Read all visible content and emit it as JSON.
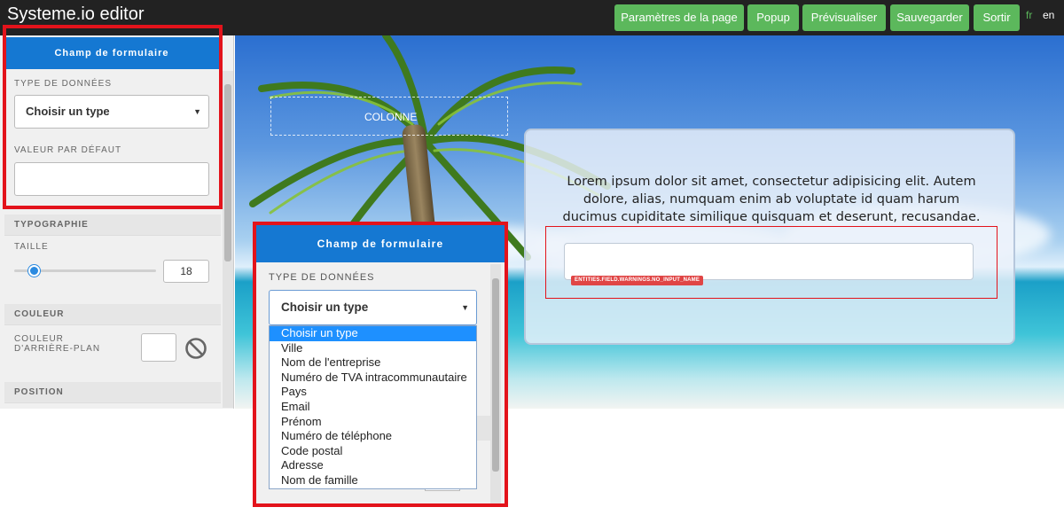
{
  "app": {
    "title": "Systeme.io editor"
  },
  "toolbar": {
    "page_settings": "Paramètres de la page",
    "popup": "Popup",
    "preview": "Prévisualiser",
    "save": "Sauvegarder",
    "exit": "Sortir",
    "lang_fr": "fr",
    "lang_en": "en"
  },
  "colors": {
    "toolbar_bg": "#222222",
    "button_green": "#5cb85c",
    "panel_blue": "#1578d2",
    "highlight_red": "#e3131b",
    "lang_active": "#5cb85c"
  },
  "sidebar": {
    "header": "Champ de formulaire",
    "data_type_label": "TYPE DE DONNÉES",
    "data_type_value": "Choisir un type",
    "default_value_label": "VALEUR PAR DÉFAUT",
    "typography_section": "TYPOGRAPHIE",
    "size_label": "TAILLE",
    "size_value": "18",
    "color_section": "COULEUR",
    "bg_color_label_1": "COULEUR",
    "bg_color_label_2": "D'ARRIÈRE-PLAN",
    "position_section": "POSITION"
  },
  "canvas": {
    "column_label": "COLONNE",
    "lorem": "Lorem ipsum dolor sit amet, consectetur adipisicing elit. Autem dolore, alias, numquam enim ab voluptate id quam harum ducimus cupiditate similique quisquam et deserunt, recusandae.",
    "field_warning": "ENTITIES.FIELD.WARNINGS.NO_INPUT_NAME"
  },
  "zoom_panel": {
    "header": "Champ de formulaire",
    "data_type_label": "TYPE DE DONNÉES",
    "data_type_value": "Choisir un type",
    "options": [
      "Choisir un type",
      "Ville",
      "Nom de l'entreprise",
      "Numéro de TVA intracommunautaire",
      "Pays",
      "Email",
      "Prénom",
      "Numéro de téléphone",
      "Code postal",
      "Adresse",
      "Nom de famille"
    ],
    "selected_index": 0
  }
}
